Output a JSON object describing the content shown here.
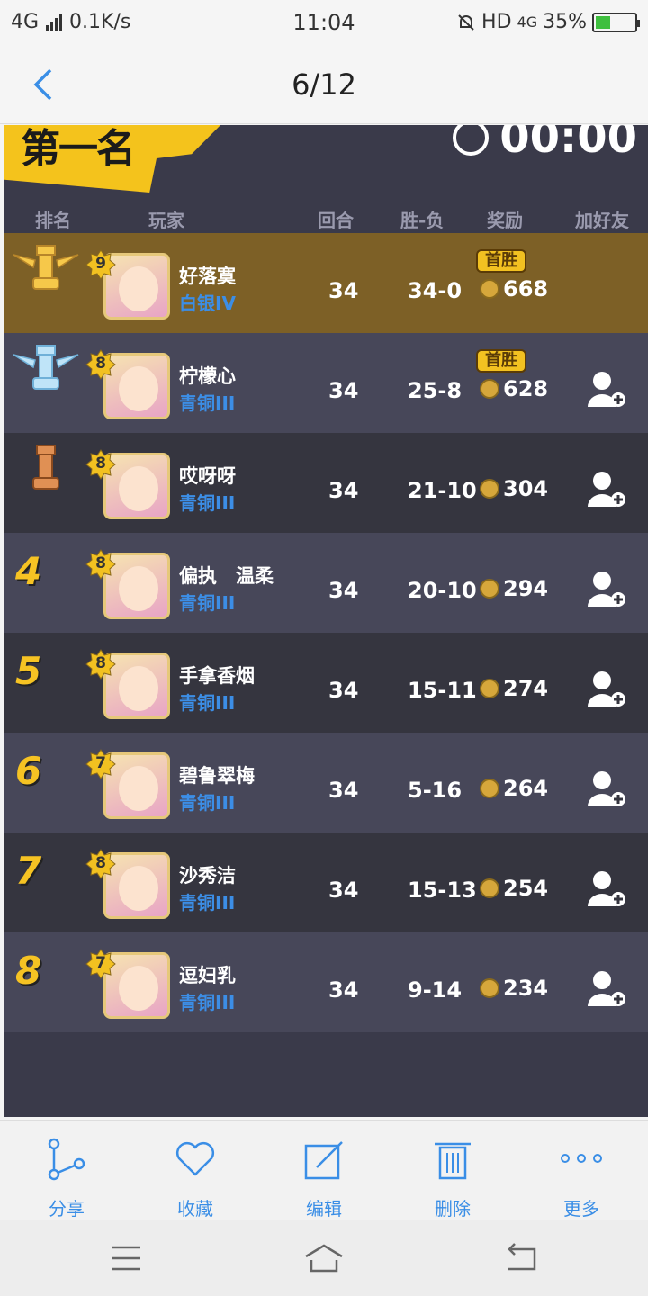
{
  "status_bar": {
    "network": "4G",
    "speed": "0.1K/s",
    "time": "11:04",
    "hd": "HD",
    "network_right": "4G",
    "battery": "35%"
  },
  "title_bar": {
    "title": "6/12"
  },
  "game": {
    "banner_text": "第一名",
    "timer": "00:00",
    "headers": {
      "rank": "排名",
      "player": "玩家",
      "rounds": "回合",
      "win_loss": "胜-负",
      "reward": "奖励",
      "add_friend": "加好友"
    },
    "first_win_label": "首胜",
    "rows": [
      {
        "rank": "1",
        "level": "9",
        "name": "好落寞",
        "tier": "白银IV",
        "rounds": "34",
        "win_loss": "34-0",
        "reward": "668",
        "first_win": true
      },
      {
        "rank": "2",
        "level": "8",
        "name": "柠檬心",
        "tier": "青铜III",
        "rounds": "34",
        "win_loss": "25-8",
        "reward": "628",
        "first_win": true
      },
      {
        "rank": "3",
        "level": "8",
        "name": "哎呀呀",
        "tier": "青铜III",
        "rounds": "34",
        "win_loss": "21-10",
        "reward": "304"
      },
      {
        "rank": "4",
        "level": "8",
        "name": "偏执　温柔",
        "tier": "青铜III",
        "rounds": "34",
        "win_loss": "20-10",
        "reward": "294"
      },
      {
        "rank": "5",
        "level": "8",
        "name": "手拿香烟",
        "tier": "青铜III",
        "rounds": "34",
        "win_loss": "15-11",
        "reward": "274"
      },
      {
        "rank": "6",
        "level": "7",
        "name": "碧鲁翠梅",
        "tier": "青铜III",
        "rounds": "34",
        "win_loss": "5-16",
        "reward": "264"
      },
      {
        "rank": "7",
        "level": "8",
        "name": "沙秀洁",
        "tier": "青铜III",
        "rounds": "34",
        "win_loss": "15-13",
        "reward": "254"
      },
      {
        "rank": "8",
        "level": "7",
        "name": "逗妇乳",
        "tier": "青铜III",
        "rounds": "34",
        "win_loss": "9-14",
        "reward": "234"
      }
    ]
  },
  "toolbar": {
    "share": "分享",
    "favorite": "收藏",
    "edit": "编辑",
    "delete": "删除",
    "more": "更多"
  },
  "colors": {
    "accent": "#3a8ee6",
    "gold": "#f6c323",
    "first_row": "#7d6026"
  }
}
